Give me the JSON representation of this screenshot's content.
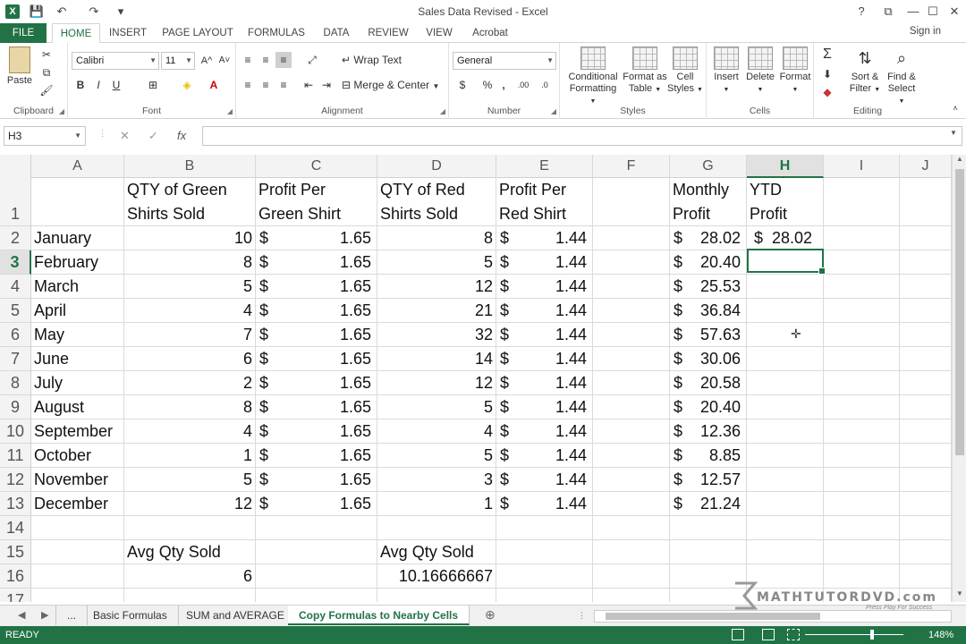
{
  "window": {
    "title": "Sales Data Revised - Excel",
    "app_icon": "X",
    "help": "?",
    "restore": "⧉",
    "minimize": "—",
    "maximize": "☐",
    "close": "✕",
    "qat_save": "💾",
    "qat_undo": "↶",
    "qat_redo": "↷",
    "qat_more": "▾"
  },
  "tabs": [
    "FILE",
    "HOME",
    "INSERT",
    "PAGE LAYOUT",
    "FORMULAS",
    "DATA",
    "REVIEW",
    "VIEW",
    "Acrobat"
  ],
  "active_tab": "HOME",
  "signin": "Sign in",
  "ribbon": {
    "clipboard": {
      "label": "Clipboard",
      "paste": "Paste"
    },
    "font": {
      "label": "Font",
      "name": "Calibri",
      "size": "11",
      "bold": "B",
      "italic": "I",
      "underline": "U",
      "grow": "A^",
      "shrink": "A˅"
    },
    "alignment": {
      "label": "Alignment",
      "wrap": "Wrap Text",
      "merge": "Merge & Center"
    },
    "number": {
      "label": "Number",
      "format": "General",
      "currency": "$",
      "percent": "%",
      "comma": ",",
      "inc_dec": ".00",
      "dec_dec": ".0"
    },
    "styles": {
      "label": "Styles",
      "conditional": "Conditional",
      "conditional2": "Formatting",
      "format_as": "Format as",
      "format_as2": "Table",
      "cell": "Cell",
      "cell2": "Styles"
    },
    "cells": {
      "label": "Cells",
      "insert": "Insert",
      "delete": "Delete",
      "format": "Format"
    },
    "editing": {
      "label": "Editing",
      "sort": "Sort &",
      "sort2": "Filter",
      "find": "Find &",
      "find2": "Select",
      "sum": "Σ"
    }
  },
  "formula_bar": {
    "name_box": "H3",
    "cancel": "✕",
    "enter": "✓",
    "fx": "fx",
    "value": ""
  },
  "columns": [
    "A",
    "B",
    "C",
    "D",
    "E",
    "F",
    "G",
    "H",
    "I",
    "J"
  ],
  "selected_column": "H",
  "selected_row": "3",
  "rows": [
    {
      "n": "1",
      "A": "",
      "B1": "QTY of Green",
      "B2": "Shirts Sold",
      "C1": "Profit Per",
      "C2": "Green Shirt",
      "D1": "QTY of Red",
      "D2": "Shirts Sold",
      "E1": "Profit Per",
      "E2": "Red Shirt",
      "G1": "Monthly",
      "G2": "Profit",
      "H1": "YTD",
      "H2": "Profit"
    },
    {
      "n": "2",
      "A": "January",
      "B": "10",
      "C": "1.65",
      "D": "8",
      "E": "1.44",
      "G": "28.02",
      "H": "28.02"
    },
    {
      "n": "3",
      "A": "February",
      "B": "8",
      "C": "1.65",
      "D": "5",
      "E": "1.44",
      "G": "20.40",
      "H": ""
    },
    {
      "n": "4",
      "A": "March",
      "B": "5",
      "C": "1.65",
      "D": "12",
      "E": "1.44",
      "G": "25.53",
      "H": ""
    },
    {
      "n": "5",
      "A": "April",
      "B": "4",
      "C": "1.65",
      "D": "21",
      "E": "1.44",
      "G": "36.84",
      "H": ""
    },
    {
      "n": "6",
      "A": "May",
      "B": "7",
      "C": "1.65",
      "D": "32",
      "E": "1.44",
      "G": "57.63",
      "H": ""
    },
    {
      "n": "7",
      "A": "June",
      "B": "6",
      "C": "1.65",
      "D": "14",
      "E": "1.44",
      "G": "30.06",
      "H": ""
    },
    {
      "n": "8",
      "A": "July",
      "B": "2",
      "C": "1.65",
      "D": "12",
      "E": "1.44",
      "G": "20.58",
      "H": ""
    },
    {
      "n": "9",
      "A": "August",
      "B": "8",
      "C": "1.65",
      "D": "5",
      "E": "1.44",
      "G": "20.40",
      "H": ""
    },
    {
      "n": "10",
      "A": "September",
      "B": "4",
      "C": "1.65",
      "D": "4",
      "E": "1.44",
      "G": "12.36",
      "H": ""
    },
    {
      "n": "11",
      "A": "October",
      "B": "1",
      "C": "1.65",
      "D": "5",
      "E": "1.44",
      "G": "8.85",
      "H": ""
    },
    {
      "n": "12",
      "A": "November",
      "B": "5",
      "C": "1.65",
      "D": "3",
      "E": "1.44",
      "G": "12.57",
      "H": ""
    },
    {
      "n": "13",
      "A": "December",
      "B": "12",
      "C": "1.65",
      "D": "1",
      "E": "1.44",
      "G": "21.24",
      "H": ""
    },
    {
      "n": "14"
    },
    {
      "n": "15",
      "B": "Avg Qty Sold",
      "D": "Avg Qty Sold"
    },
    {
      "n": "16",
      "B": "6",
      "D": "10.16666667"
    },
    {
      "n": "17"
    }
  ],
  "currency_symbol": "$",
  "sheets": [
    "...",
    "Basic Formulas",
    "SUM and AVERAGE",
    "Copy Formulas to Nearby Cells"
  ],
  "active_sheet": "Copy Formulas to Nearby Cells",
  "status": "READY",
  "zoom": "148%",
  "watermark": {
    "brand": "MATHTUTORDVD.com",
    "tagline": "Press Play For Success"
  }
}
